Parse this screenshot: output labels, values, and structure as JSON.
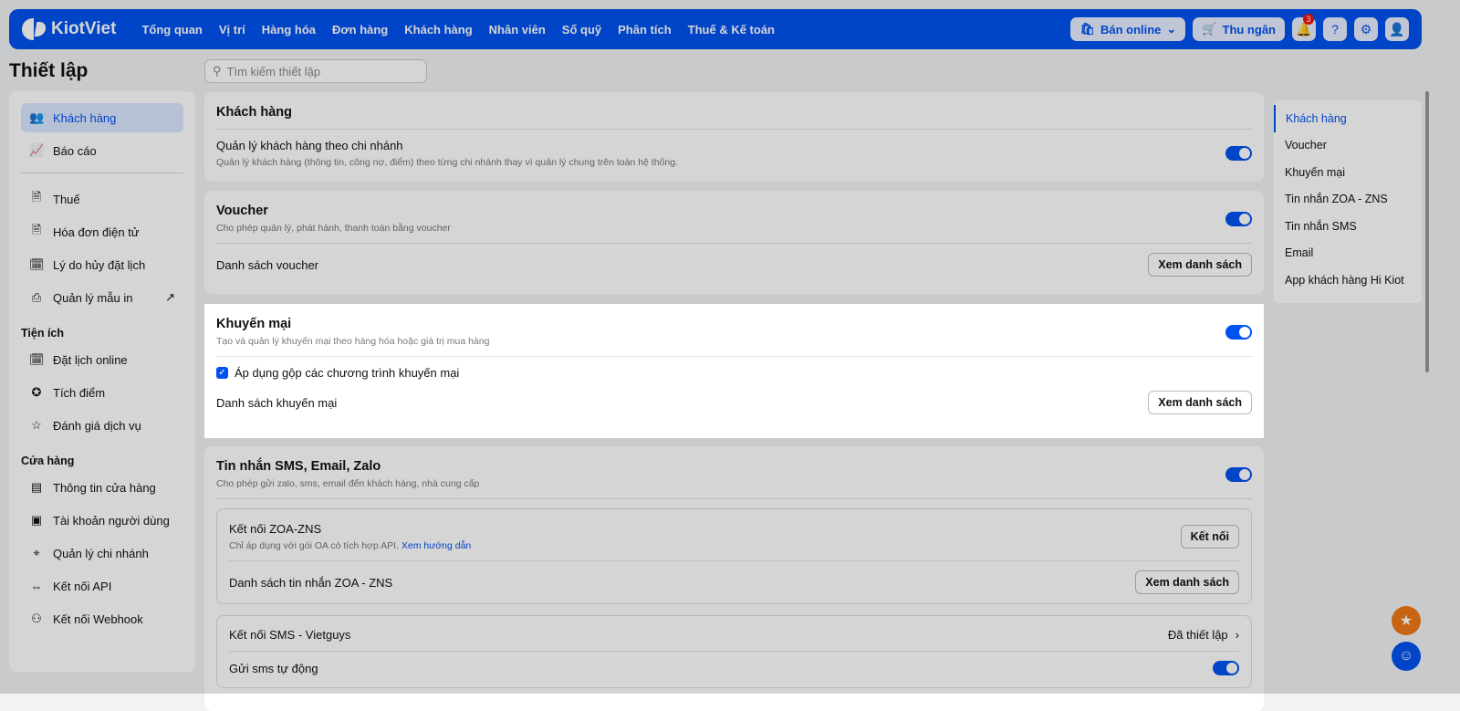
{
  "header": {
    "brand": "KiotViet",
    "menu": [
      "Tổng quan",
      "Vị trí",
      "Hàng hóa",
      "Đơn hàng",
      "Khách hàng",
      "Nhân viên",
      "Sổ quỹ",
      "Phân tích",
      "Thuế & Kế toán"
    ],
    "online": "Bán online",
    "cashier": "Thu ngân",
    "notif_count": "3"
  },
  "page": {
    "title": "Thiết lập",
    "search_placeholder": "Tìm kiếm thiết lập"
  },
  "sidebar": {
    "items": [
      {
        "label": "Khách hàng",
        "icon": "👥"
      },
      {
        "label": "Báo cáo",
        "icon": "📈"
      },
      {
        "label": "Thuế",
        "icon": "🗎"
      },
      {
        "label": "Hóa đơn điện tử",
        "icon": "🗎"
      },
      {
        "label": "Lý do hủy đặt lịch",
        "icon": "🗓"
      },
      {
        "label": "Quản lý mẫu in",
        "icon": "⎙"
      }
    ],
    "sec1": "Tiện ích",
    "items2": [
      {
        "label": "Đặt lịch online",
        "icon": "🗓"
      },
      {
        "label": "Tích điểm",
        "icon": "✪"
      },
      {
        "label": "Đánh giá dịch vụ",
        "icon": "☆"
      }
    ],
    "sec2": "Cửa hàng",
    "items3": [
      {
        "label": "Thông tin cửa hàng",
        "icon": "▤"
      },
      {
        "label": "Tài khoản người dùng",
        "icon": "▣"
      },
      {
        "label": "Quản lý chi nhánh",
        "icon": "⌖"
      },
      {
        "label": "Kết nối API",
        "icon": "⇔"
      },
      {
        "label": "Kết nối Webhook",
        "icon": "⚇"
      }
    ]
  },
  "cards": {
    "customer": {
      "title": "Khách hàng",
      "opt": "Quản lý khách hàng theo chi nhánh",
      "desc": "Quản lý khách hàng (thông tin, công nợ, điểm) theo từng chi nhánh thay vì quản lý chung trên toàn hệ thống."
    },
    "voucher": {
      "title": "Voucher",
      "desc": "Cho phép quản lý, phát hành, thanh toán bằng voucher",
      "list": "Danh sách voucher",
      "btn": "Xem danh sách"
    },
    "promo": {
      "title": "Khuyến mại",
      "desc": "Tạo và quản lý khuyến mại theo hàng hóa hoặc giá trị mua hàng",
      "check": "Áp dụng gộp các chương trình khuyến mại",
      "list": "Danh sách khuyến mại",
      "btn": "Xem danh sách"
    },
    "sms": {
      "title": "Tin nhắn SMS, Email, Zalo",
      "desc": "Cho phép gửi zalo, sms, email đến khách hàng, nhà cung cấp",
      "zns": "Kết nối ZOA-ZNS",
      "zns_desc": "Chỉ áp dụng với gói OA có tích hợp API.",
      "zns_link": "Xem hướng dẫn",
      "connect": "Kết nối",
      "zns_list": "Danh sách tin nhắn ZOA - ZNS",
      "btn": "Xem danh sách",
      "vg": "Kết nối SMS - Vietguys",
      "vg_status": "Đã thiết lập",
      "auto": "Gửi sms tự động"
    }
  },
  "rightnav": [
    "Khách hàng",
    "Voucher",
    "Khuyến mại",
    "Tin nhắn ZOA - ZNS",
    "Tin nhắn SMS",
    "Email",
    "App khách hàng Hi Kiot"
  ]
}
